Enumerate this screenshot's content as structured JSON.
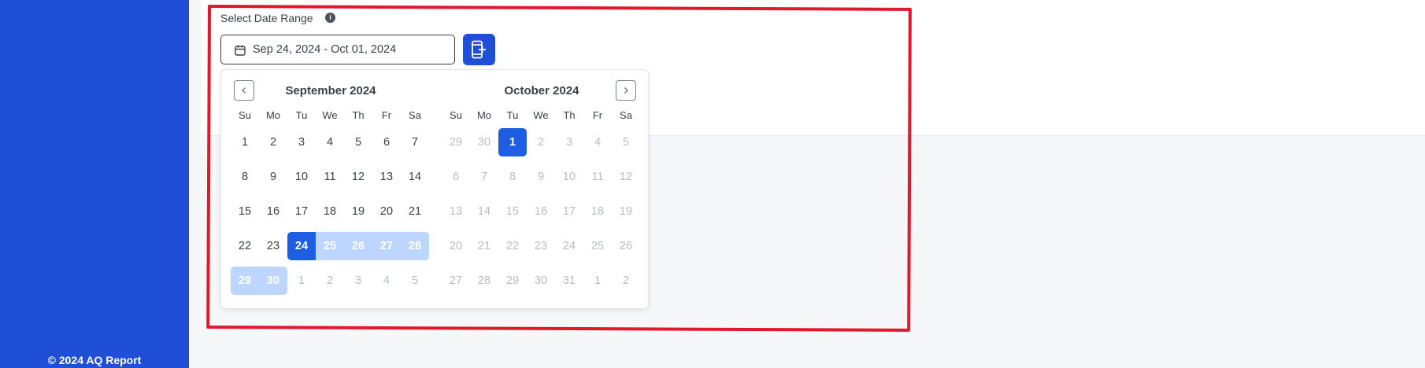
{
  "sidebar": {
    "footer": "© 2024 AQ Report"
  },
  "filter": {
    "label": "Select Date Range",
    "info_icon": "info-icon",
    "date_range_value": "Sep 24, 2024 - Oct 01, 2024",
    "export_icon": "export-icon"
  },
  "calendar": {
    "weekdays": [
      "Su",
      "Mo",
      "Tu",
      "We",
      "Th",
      "Fr",
      "Sa"
    ],
    "months": [
      {
        "title": "September 2024",
        "weeks": [
          [
            {
              "d": "1"
            },
            {
              "d": "2"
            },
            {
              "d": "3"
            },
            {
              "d": "4"
            },
            {
              "d": "5"
            },
            {
              "d": "6"
            },
            {
              "d": "7"
            }
          ],
          [
            {
              "d": "8"
            },
            {
              "d": "9"
            },
            {
              "d": "10"
            },
            {
              "d": "11"
            },
            {
              "d": "12"
            },
            {
              "d": "13"
            },
            {
              "d": "14"
            }
          ],
          [
            {
              "d": "15"
            },
            {
              "d": "16"
            },
            {
              "d": "17"
            },
            {
              "d": "18"
            },
            {
              "d": "19"
            },
            {
              "d": "20"
            },
            {
              "d": "21"
            }
          ],
          [
            {
              "d": "22"
            },
            {
              "d": "23"
            },
            {
              "d": "24",
              "s": "sel-start"
            },
            {
              "d": "25",
              "s": "range"
            },
            {
              "d": "26",
              "s": "range"
            },
            {
              "d": "27",
              "s": "range"
            },
            {
              "d": "28",
              "s": "range-end"
            }
          ],
          [
            {
              "d": "29",
              "s": "range-start"
            },
            {
              "d": "30",
              "s": "range-end"
            },
            {
              "d": "1",
              "s": "muted"
            },
            {
              "d": "2",
              "s": "muted"
            },
            {
              "d": "3",
              "s": "muted"
            },
            {
              "d": "4",
              "s": "muted"
            },
            {
              "d": "5",
              "s": "muted"
            }
          ]
        ]
      },
      {
        "title": "October 2024",
        "weeks": [
          [
            {
              "d": "29",
              "s": "muted"
            },
            {
              "d": "30",
              "s": "muted"
            },
            {
              "d": "1",
              "s": "sel-single"
            },
            {
              "d": "2",
              "s": "muted"
            },
            {
              "d": "3",
              "s": "muted"
            },
            {
              "d": "4",
              "s": "muted"
            },
            {
              "d": "5",
              "s": "muted"
            }
          ],
          [
            {
              "d": "6",
              "s": "muted"
            },
            {
              "d": "7",
              "s": "muted"
            },
            {
              "d": "8",
              "s": "muted"
            },
            {
              "d": "9",
              "s": "muted"
            },
            {
              "d": "10",
              "s": "muted"
            },
            {
              "d": "11",
              "s": "muted"
            },
            {
              "d": "12",
              "s": "muted"
            }
          ],
          [
            {
              "d": "13",
              "s": "muted"
            },
            {
              "d": "14",
              "s": "muted"
            },
            {
              "d": "15",
              "s": "muted"
            },
            {
              "d": "16",
              "s": "muted"
            },
            {
              "d": "17",
              "s": "muted"
            },
            {
              "d": "18",
              "s": "muted"
            },
            {
              "d": "19",
              "s": "muted"
            }
          ],
          [
            {
              "d": "20",
              "s": "muted"
            },
            {
              "d": "21",
              "s": "muted"
            },
            {
              "d": "22",
              "s": "muted"
            },
            {
              "d": "23",
              "s": "muted"
            },
            {
              "d": "24",
              "s": "muted"
            },
            {
              "d": "25",
              "s": "muted"
            },
            {
              "d": "26",
              "s": "muted"
            }
          ],
          [
            {
              "d": "27",
              "s": "muted"
            },
            {
              "d": "28",
              "s": "muted"
            },
            {
              "d": "29",
              "s": "muted"
            },
            {
              "d": "30",
              "s": "muted"
            },
            {
              "d": "31",
              "s": "muted"
            },
            {
              "d": "1",
              "s": "muted"
            },
            {
              "d": "2",
              "s": "muted"
            }
          ]
        ]
      }
    ]
  },
  "colors": {
    "sidebar": "#1e4fd6",
    "selected_day": "#1e5ee3",
    "range_day": "#bcd6ff",
    "annotation": "#e0192e"
  }
}
